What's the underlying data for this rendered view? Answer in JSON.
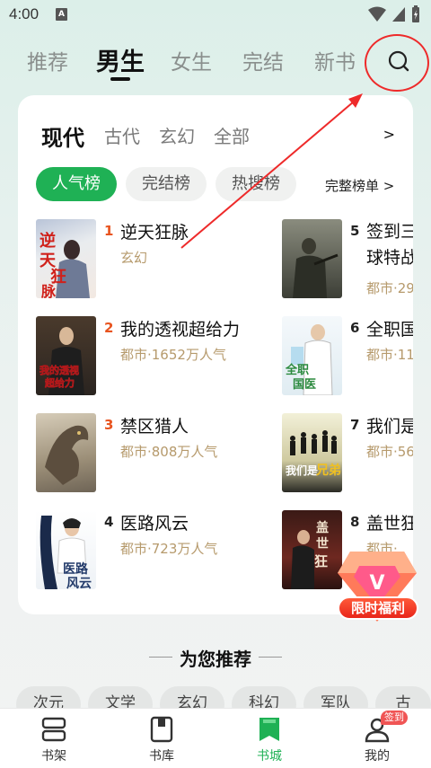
{
  "status": {
    "time": "4:00",
    "app_icon": "A"
  },
  "top_tabs": [
    "推荐",
    "男生",
    "女生",
    "完结",
    "新书"
  ],
  "top_tab_active": "男生",
  "sub_tabs": [
    "现代",
    "古代",
    "玄幻",
    "全部"
  ],
  "sub_more": ">",
  "rank_pills": [
    "人气榜",
    "完结榜",
    "热搜榜"
  ],
  "full_list": "完整榜单 >",
  "books": [
    {
      "rank": "1",
      "title": "逆天狂脉",
      "meta": "玄幻",
      "rank_color": "#e8541f",
      "cover_text": "逆天狂脉"
    },
    {
      "rank": "2",
      "title": "我的透视超给力",
      "meta": "都市·1652万人气",
      "rank_color": "#e8541f",
      "cover_text": "我的透视超给力"
    },
    {
      "rank": "3",
      "title": "禁区猎人",
      "meta": "都市·808万人气",
      "rank_color": "#e8541f",
      "cover_text": ""
    },
    {
      "rank": "4",
      "title": "医路风云",
      "meta": "都市·723万人气",
      "rank_color": "#222",
      "cover_text": "医路风云"
    },
    {
      "rank": "5",
      "title": "签到三球特战",
      "title_line1": "签到三",
      "title_line2": "球特战",
      "meta": "都市·29",
      "rank_color": "#222",
      "cover_text": ""
    },
    {
      "rank": "6",
      "title": "全职国",
      "meta": "都市·11",
      "rank_color": "#222",
      "cover_text": "全职国医"
    },
    {
      "rank": "7",
      "title": "我们是",
      "meta": "都市·56",
      "rank_color": "#222",
      "cover_text": "我们是兄弟"
    },
    {
      "rank": "8",
      "title": "盖世狂",
      "meta": "都市·",
      "rank_color": "#222",
      "cover_text": "盖世狂龙"
    }
  ],
  "promo_label": "限时福利",
  "recommend_title": "为您推荐",
  "categories": [
    "次元",
    "文学",
    "玄幻",
    "科幻",
    "军队",
    "古"
  ],
  "bottom_nav": [
    {
      "label": "书架",
      "icon": "bookshelf-icon"
    },
    {
      "label": "书库",
      "icon": "library-icon"
    },
    {
      "label": "书城",
      "icon": "bookstore-icon"
    },
    {
      "label": "我的",
      "icon": "profile-icon"
    }
  ],
  "sign_badge": "签到",
  "colors": {
    "accent": "#1fb155",
    "rank_hot": "#e8541f",
    "meta": "#b69a6c",
    "annotation": "#ee2a2a"
  }
}
